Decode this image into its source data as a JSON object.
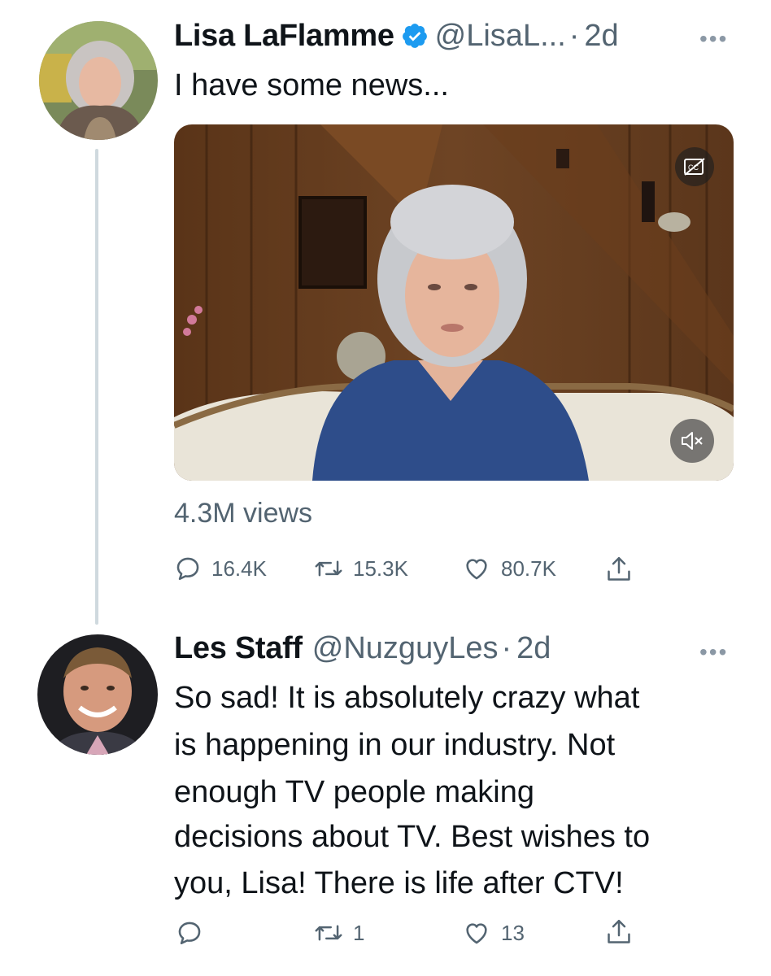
{
  "tweet1": {
    "name": "Lisa LaFlamme",
    "handle": "@LisaL...",
    "time": "2d",
    "text": "I have some news...",
    "views": "4.3M views",
    "replies": "16.4K",
    "retweets": "15.3K",
    "likes": "80.7K"
  },
  "reply": {
    "name": "Les Staff",
    "handle": "@NuzguyLes",
    "time": "2d",
    "lines": [
      "So sad! It is absolutely crazy what",
      "is happening in our industry. Not",
      "enough TV people making",
      "decisions about TV. Best wishes to",
      "you, Lisa! There is life after CTV!"
    ],
    "replies": "",
    "retweets": "1",
    "likes": "13"
  },
  "ui": {
    "separator_dot": "·",
    "more_glyph": "•••"
  },
  "colors": {
    "verified_blue": "#1d9bf0",
    "secondary_text": "#536471",
    "thread_line": "#cfd9de"
  }
}
